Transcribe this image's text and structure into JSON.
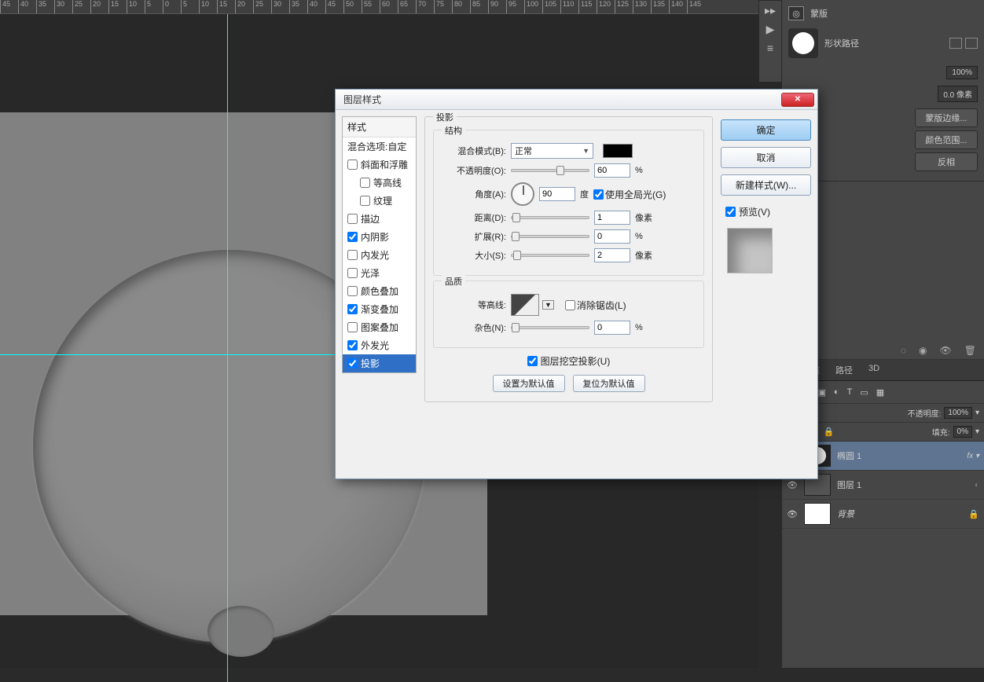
{
  "dialog": {
    "title": "图层样式",
    "styles_header": "样式",
    "blend_header": "混合选项:自定",
    "items": {
      "bevel": "斜面和浮雕",
      "contour": "等高线",
      "texture": "纹理",
      "stroke": "描边",
      "inner_shadow": "内阴影",
      "inner_glow": "内发光",
      "satin": "光泽",
      "color_overlay": "颜色叠加",
      "gradient_overlay": "渐变叠加",
      "pattern_overlay": "图案叠加",
      "outer_glow": "外发光",
      "drop_shadow": "投影"
    },
    "section_main": "投影",
    "section_structure": "结构",
    "blend_mode_label": "混合模式(B):",
    "blend_mode_value": "正常",
    "opacity_label": "不透明度(O):",
    "opacity_value": "60",
    "pct": "%",
    "angle_label": "角度(A):",
    "angle_value": "90",
    "deg": "度",
    "global_light": "使用全局光(G)",
    "distance_label": "距离(D):",
    "distance_value": "1",
    "px": "像素",
    "spread_label": "扩展(R):",
    "spread_value": "0",
    "size_label": "大小(S):",
    "size_value": "2",
    "section_quality": "品质",
    "contour_label": "等高线:",
    "anti_alias": "消除锯齿(L)",
    "noise_label": "杂色(N):",
    "noise_value": "0",
    "knockout": "图层挖空投影(U)",
    "make_default": "设置为默认值",
    "reset_default": "复位为默认值",
    "ok": "确定",
    "cancel": "取消",
    "new_style": "新建样式(W)...",
    "preview": "预览(V)"
  },
  "panels": {
    "masks_title": "蒙版",
    "shape_path": "形状路径",
    "density_pct": "100%",
    "feather": "0.0 像素",
    "btn_mask_edge": "蒙版边缘...",
    "btn_color_range": "颜色范围...",
    "btn_invert": "反相",
    "tab_channels": "通道",
    "tab_paths": "路径",
    "tab_3d": "3D",
    "opacity_label": "不透明度:",
    "opacity_val": "100%",
    "fill_label": "填充:",
    "fill_val": "0%",
    "layer_ellipse": "椭圆 1",
    "layer_layer1": "图层 1",
    "layer_bg": "背景"
  }
}
